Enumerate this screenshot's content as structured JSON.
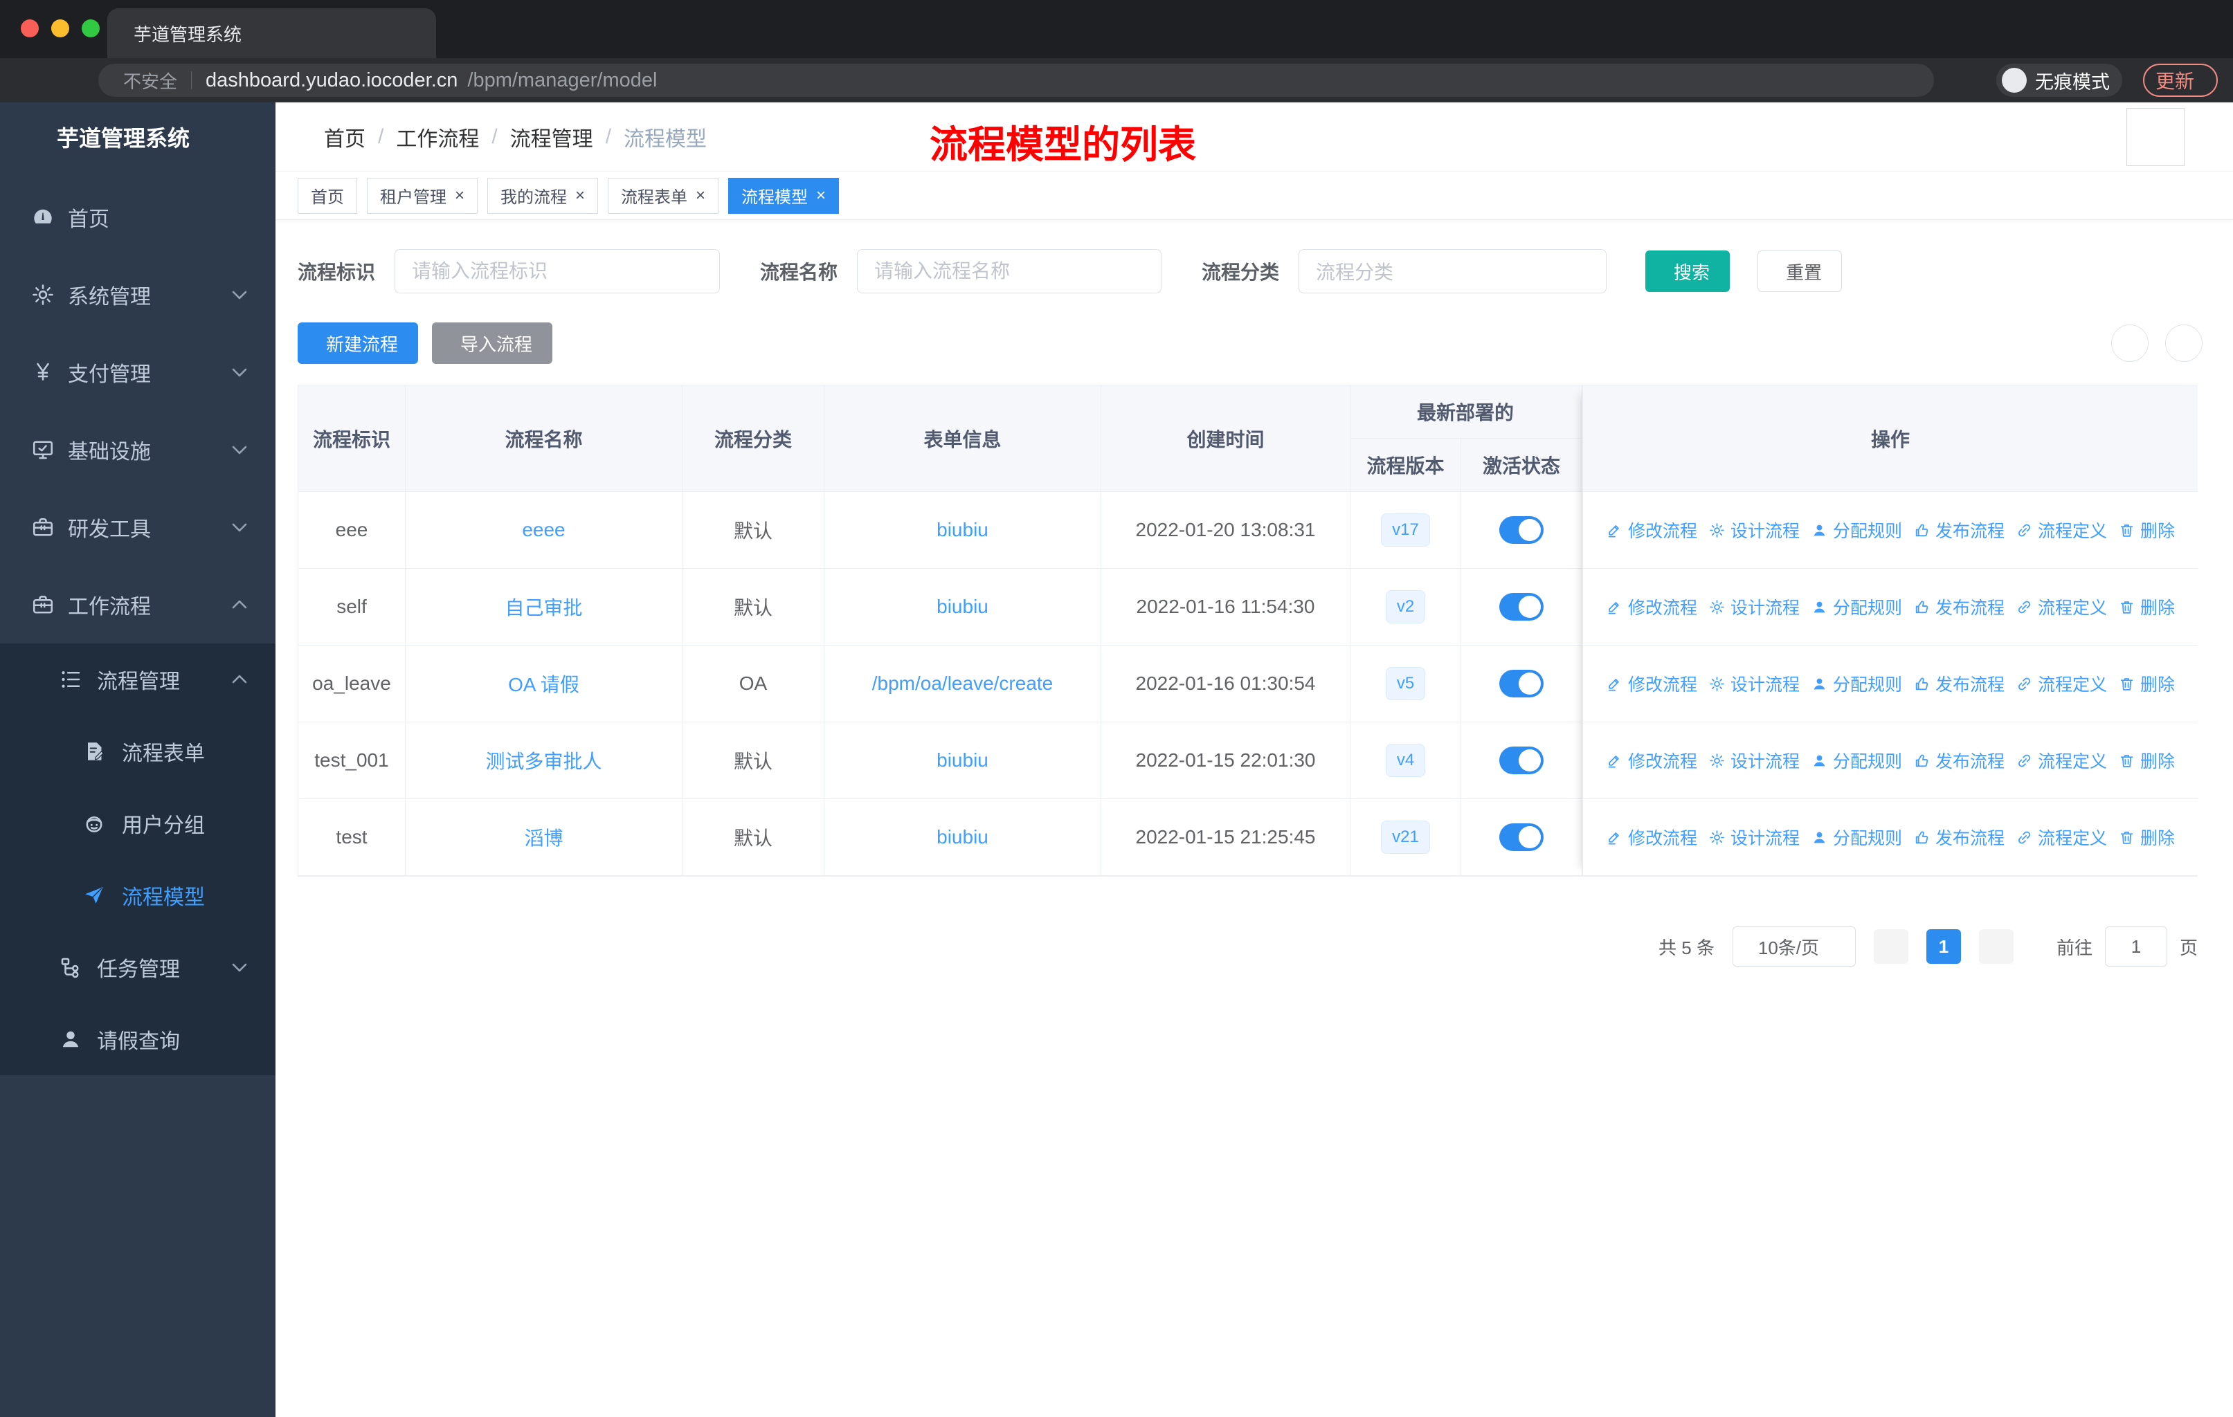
{
  "browser": {
    "tab_title": "芋道管理系统",
    "security_label": "不安全",
    "url_host": "dashboard.yudao.iocoder.cn",
    "url_path": "/bpm/manager/model",
    "incognito_label": "无痕模式",
    "update_label": "更新"
  },
  "sidebar": {
    "app_title": "芋道管理系统",
    "menu": [
      {
        "key": "home",
        "icon": "dashboard",
        "label": "首页",
        "level": 1
      },
      {
        "key": "system",
        "icon": "gear-line",
        "label": "系统管理",
        "level": 1,
        "chevron": "down"
      },
      {
        "key": "payment",
        "icon": "yen",
        "label": "支付管理",
        "level": 1,
        "chevron": "down"
      },
      {
        "key": "infrastructure",
        "icon": "monitor",
        "label": "基础设施",
        "level": 1,
        "chevron": "down"
      },
      {
        "key": "dev-tools",
        "icon": "toolbox",
        "label": "研发工具",
        "level": 1,
        "chevron": "down"
      },
      {
        "key": "workflow",
        "icon": "toolbox",
        "label": "工作流程",
        "level": 1,
        "chevron": "up"
      },
      {
        "key": "process-mgmt",
        "icon": "list-tree",
        "label": "流程管理",
        "level": 2,
        "chevron": "up",
        "dark": true
      },
      {
        "key": "process-form",
        "icon": "doc-edit",
        "label": "流程表单",
        "level": 3,
        "dark": true
      },
      {
        "key": "user-group",
        "icon": "robot",
        "label": "用户分组",
        "level": 3,
        "dark": true
      },
      {
        "key": "process-model",
        "icon": "paper-plane",
        "label": "流程模型",
        "level": 3,
        "dark": true,
        "active": true
      },
      {
        "key": "task-mgmt",
        "icon": "flow",
        "label": "任务管理",
        "level": 2,
        "chevron": "down",
        "dark": true
      },
      {
        "key": "leave-query",
        "icon": "person",
        "label": "请假查询",
        "level": 2,
        "dark": true
      }
    ]
  },
  "header": {
    "breadcrumb": [
      "首页",
      "工作流程",
      "流程管理",
      "流程模型"
    ],
    "annotation": "流程模型的列表"
  },
  "tags": [
    {
      "key": "home",
      "label": "首页",
      "closable": false,
      "active": false
    },
    {
      "key": "tenant",
      "label": "租户管理",
      "closable": true,
      "active": false
    },
    {
      "key": "my-process",
      "label": "我的流程",
      "closable": true,
      "active": false
    },
    {
      "key": "process-form",
      "label": "流程表单",
      "closable": true,
      "active": false
    },
    {
      "key": "process-model",
      "label": "流程模型",
      "closable": true,
      "active": true
    }
  ],
  "filters": {
    "id_label": "流程标识",
    "id_placeholder": "请输入流程标识",
    "name_label": "流程名称",
    "name_placeholder": "请输入流程名称",
    "category_label": "流程分类",
    "category_placeholder": "流程分类",
    "search_label": "搜索",
    "reset_label": "重置"
  },
  "toolbar": {
    "create_label": "新建流程",
    "import_label": "导入流程"
  },
  "table": {
    "headers": {
      "id": "流程标识",
      "name": "流程名称",
      "category": "流程分类",
      "form": "表单信息",
      "created": "创建时间",
      "group": "最新部署的",
      "version": "流程版本",
      "status": "激活状态",
      "actions": "操作"
    },
    "rows": [
      {
        "id": "eee",
        "name": "eeee",
        "category": "默认",
        "form": "biubiu",
        "created": "2022-01-20 13:08:31",
        "version": "v17",
        "active": true
      },
      {
        "id": "self",
        "name": "自己审批",
        "category": "默认",
        "form": "biubiu",
        "created": "2022-01-16 11:54:30",
        "version": "v2",
        "active": true
      },
      {
        "id": "oa_leave",
        "name": "OA 请假",
        "category": "OA",
        "form": "/bpm/oa/leave/create",
        "created": "2022-01-16 01:30:54",
        "version": "v5",
        "active": true
      },
      {
        "id": "test_001",
        "name": "测试多审批人",
        "category": "默认",
        "form": "biubiu",
        "created": "2022-01-15 22:01:30",
        "version": "v4",
        "active": true
      },
      {
        "id": "test",
        "name": "滔博",
        "category": "默认",
        "form": "biubiu",
        "created": "2022-01-15 21:25:45",
        "version": "v21",
        "active": true
      }
    ],
    "row_actions": [
      {
        "key": "modify",
        "icon": "edit",
        "label": "修改流程"
      },
      {
        "key": "design",
        "icon": "gear-line",
        "label": "设计流程"
      },
      {
        "key": "assign",
        "icon": "user",
        "label": "分配规则"
      },
      {
        "key": "deploy",
        "icon": "thumb",
        "label": "发布流程"
      },
      {
        "key": "definition",
        "icon": "link",
        "label": "流程定义"
      },
      {
        "key": "delete",
        "icon": "trash",
        "label": "删除"
      }
    ]
  },
  "pagination": {
    "total": "共 5 条",
    "page_size": "10条/页",
    "current_page": "1",
    "goto_label": "前往",
    "goto_value": "1",
    "unit_label": "页"
  },
  "colors": {
    "accent_blue": "#2d8cf0",
    "link_blue": "#409eff",
    "search_teal": "#10b3a1",
    "import_gray": "#909399",
    "annotation_red": "#ff0000",
    "update_coral": "#f28b82",
    "sidebar_bg": "#2d3a4b",
    "submenu_bg": "#1f2d3d"
  }
}
